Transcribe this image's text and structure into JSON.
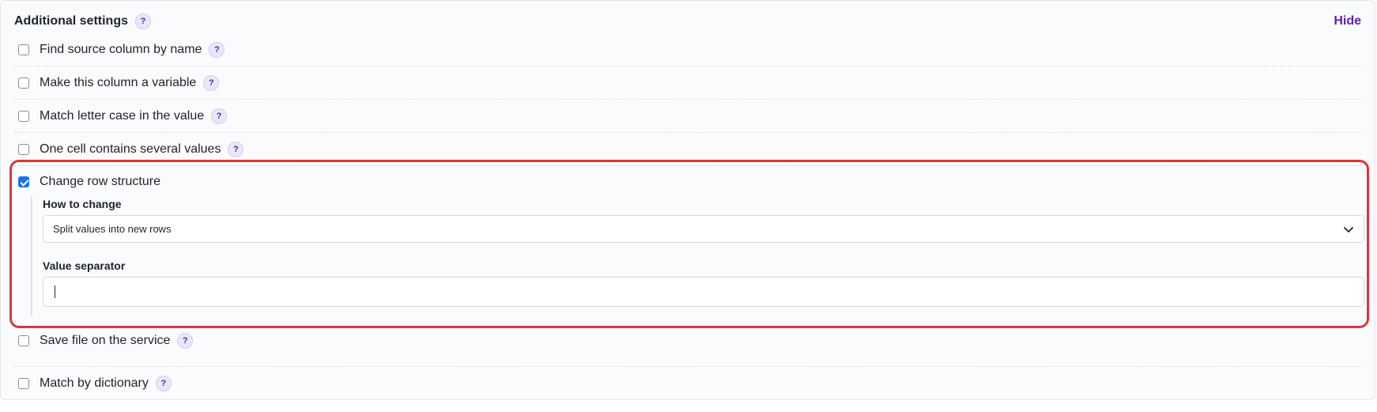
{
  "header": {
    "title": "Additional settings",
    "help_glyph": "?",
    "hide_label": "Hide"
  },
  "options": [
    {
      "label": "Find source column by name",
      "checked": false,
      "has_help": true
    },
    {
      "label": "Make this column a variable",
      "checked": false,
      "has_help": true
    },
    {
      "label": "Match letter case in the value",
      "checked": false,
      "has_help": true
    },
    {
      "label": "One cell contains several values",
      "checked": false,
      "has_help": true
    },
    {
      "label": "Change row structure",
      "checked": true,
      "has_help": false
    },
    {
      "label": "Save file on the service",
      "checked": false,
      "has_help": true
    },
    {
      "label": "Match by dictionary",
      "checked": false,
      "has_help": true
    }
  ],
  "row_structure": {
    "how_label": "How to change",
    "how_value": "Split values into new rows",
    "separator_label": "Value separator",
    "separator_value": ""
  },
  "colors": {
    "accent_purple": "#5b1fb6",
    "highlight_red": "#d9363e",
    "checkbox_blue": "#1a73e8"
  },
  "icons": {
    "help": "question-mark-circle",
    "select_arrow": "chevron-down"
  }
}
